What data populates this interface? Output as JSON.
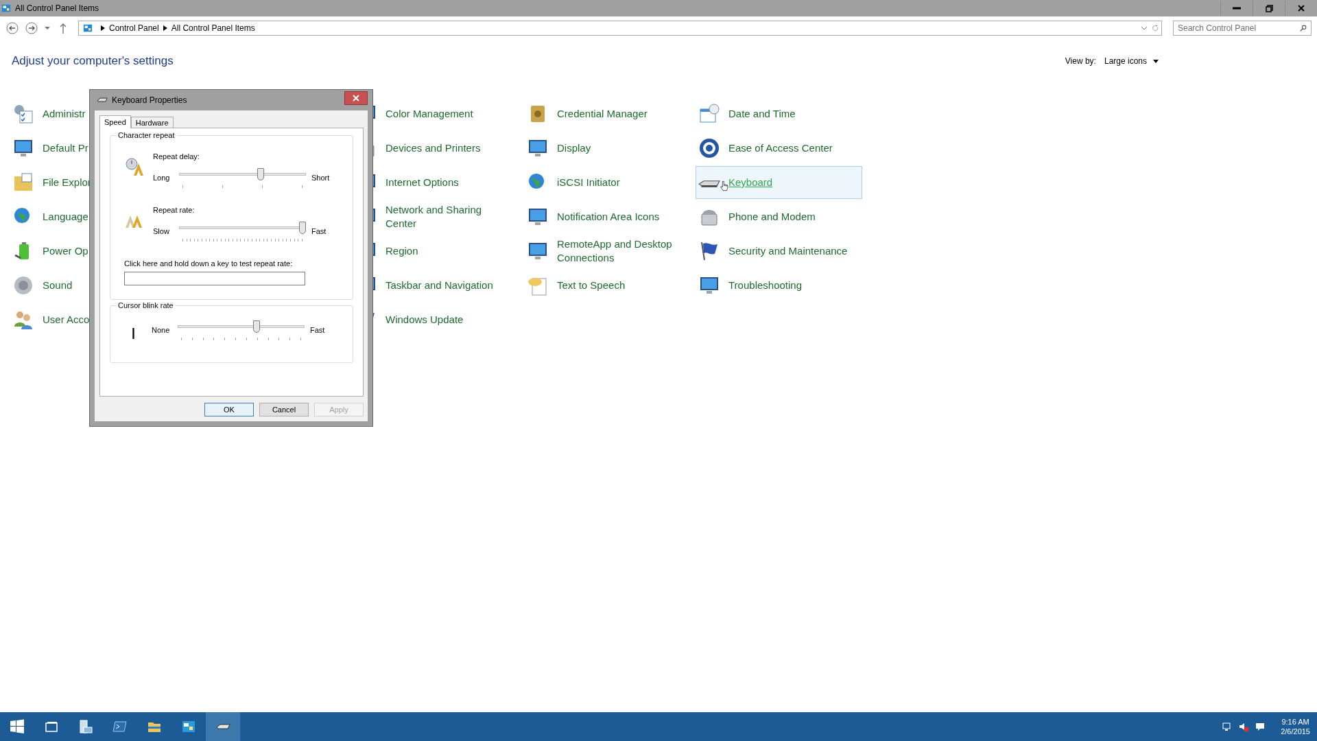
{
  "window": {
    "title": "All Control Panel Items"
  },
  "address_bar": {
    "breadcrumbs": [
      "Control Panel",
      "All Control Panel Items"
    ]
  },
  "search": {
    "placeholder": "Search Control Panel"
  },
  "heading": "Adjust your computer's settings",
  "view_by": {
    "label": "View by:",
    "value": "Large icons"
  },
  "columns": [
    {
      "items": [
        {
          "label": "Administr",
          "selected": false
        },
        {
          "label": "Default Pr",
          "selected": false
        },
        {
          "label": "File Explor",
          "selected": false
        },
        {
          "label": "Language",
          "selected": false
        },
        {
          "label": "Power Op",
          "selected": false
        },
        {
          "label": "Sound",
          "selected": false
        },
        {
          "label": "User Acco",
          "selected": false
        }
      ]
    },
    {
      "items": [
        {
          "label": "Color Management",
          "selected": false
        },
        {
          "label": "Devices and Printers",
          "selected": false
        },
        {
          "label": "Internet Options",
          "selected": false
        },
        {
          "label": "Network and Sharing Center",
          "selected": false
        },
        {
          "label": "Region",
          "selected": false
        },
        {
          "label": "Taskbar and Navigation",
          "selected": false
        },
        {
          "label": "Windows Update",
          "selected": false
        }
      ]
    },
    {
      "items": [
        {
          "label": "Credential Manager",
          "selected": false
        },
        {
          "label": "Display",
          "selected": false
        },
        {
          "label": "iSCSI Initiator",
          "selected": false
        },
        {
          "label": "Notification Area Icons",
          "selected": false
        },
        {
          "label": "RemoteApp and Desktop Connections",
          "selected": false
        },
        {
          "label": "Text to Speech",
          "selected": false
        }
      ]
    },
    {
      "items": [
        {
          "label": "Date and Time",
          "selected": false
        },
        {
          "label": "Ease of Access Center",
          "selected": false
        },
        {
          "label": "Keyboard",
          "selected": true
        },
        {
          "label": "Phone and Modem",
          "selected": false
        },
        {
          "label": "Security and Maintenance",
          "selected": false
        },
        {
          "label": "Troubleshooting",
          "selected": false
        }
      ]
    }
  ],
  "dialog": {
    "title": "Keyboard Properties",
    "tabs": [
      {
        "label": "Speed",
        "selected": true
      },
      {
        "label": "Hardware",
        "selected": false
      }
    ],
    "groups": [
      {
        "title": "Character repeat",
        "sliders": [
          {
            "label": "Repeat delay:",
            "min_label": "Long",
            "max_label": "Short",
            "level": 0.65
          },
          {
            "label": "Repeat rate:",
            "min_label": "Slow",
            "max_label": "Fast",
            "level": 1.0
          }
        ],
        "test_field": {
          "label": "Click here and hold down a key to test repeat rate:"
        }
      },
      {
        "title": "Cursor blink rate",
        "sliders": [
          {
            "min_label": "None",
            "max_label": "Fast",
            "level": 0.63
          }
        ]
      }
    ],
    "buttons": [
      {
        "label": "OK",
        "default": true,
        "disabled": false
      },
      {
        "label": "Cancel",
        "default": false,
        "disabled": false
      },
      {
        "label": "Apply",
        "default": false,
        "disabled": true
      }
    ]
  },
  "taskbar": {
    "apps": [
      {
        "selected": false
      },
      {
        "selected": false
      },
      {
        "selected": false
      },
      {
        "selected": false
      },
      {
        "selected": false
      },
      {
        "selected": true
      }
    ],
    "clock": {
      "time": "9:16 AM",
      "date": "2/6/2015"
    }
  }
}
